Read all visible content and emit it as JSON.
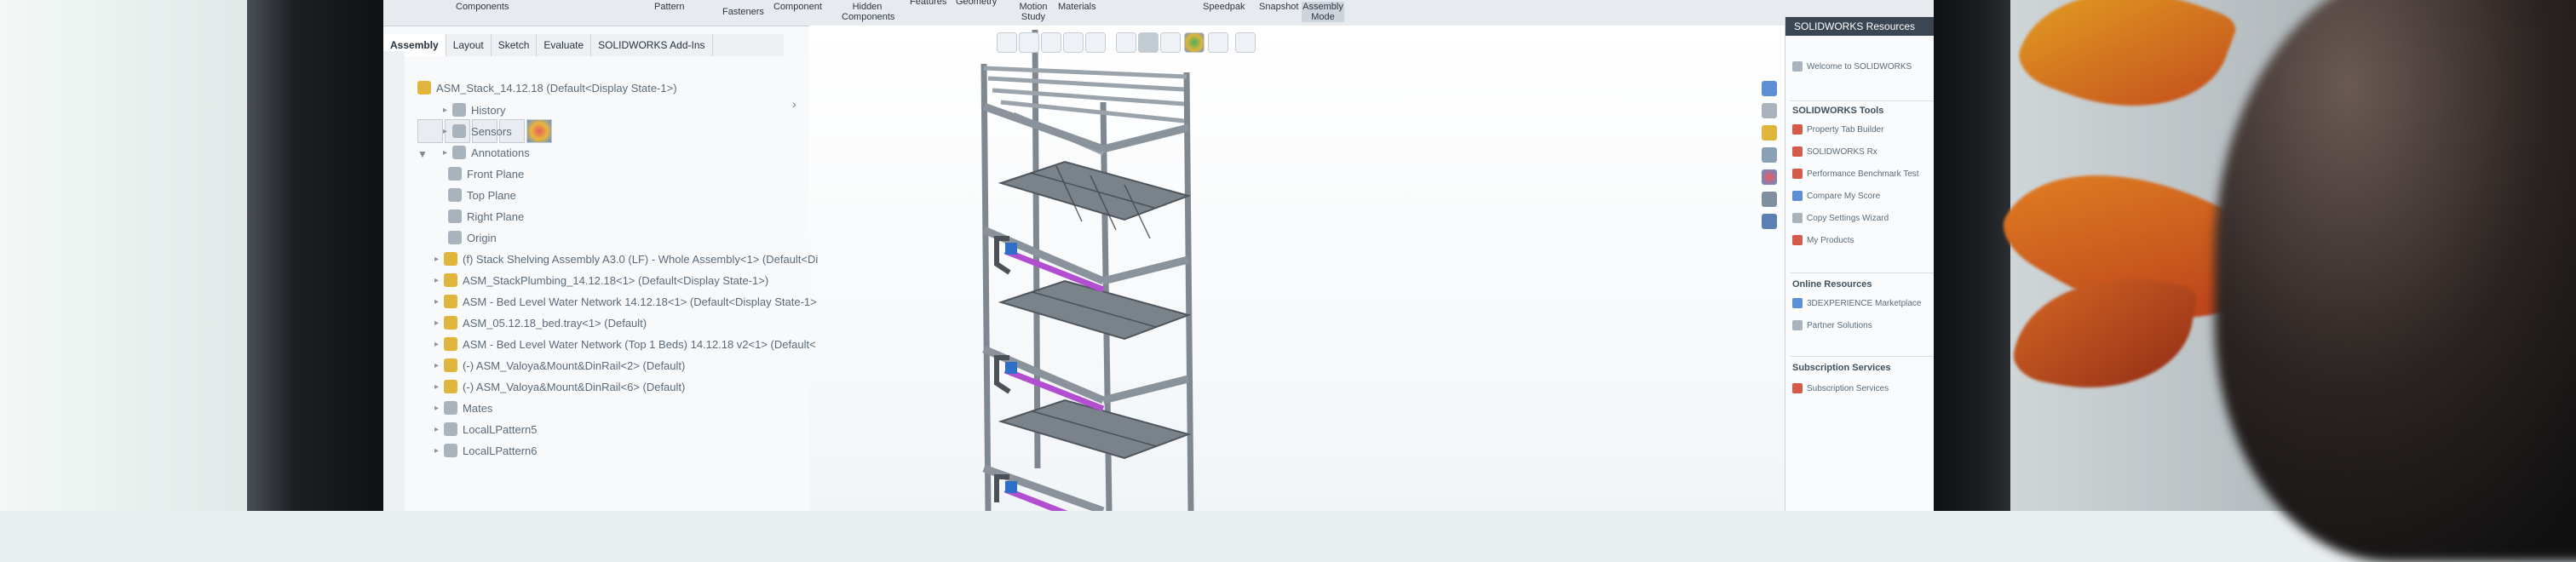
{
  "ribbon": {
    "items": [
      "Components",
      "Pattern",
      "Fasteners",
      "Component",
      "Hidden Components",
      "Features",
      "Geometry",
      "Motion Study",
      "Materials",
      "Speedpak",
      "Snapshot",
      "Assembly Mode"
    ]
  },
  "tabs": [
    "Assembly",
    "Layout",
    "Sketch",
    "Evaluate",
    "SOLIDWORKS Add-Ins"
  ],
  "tree": {
    "root": "ASM_Stack_14.12.18  (Default<Display State-1>)",
    "items": [
      {
        "label": "History",
        "icon": "folder-icon"
      },
      {
        "label": "Sensors",
        "icon": "sensor-icon"
      },
      {
        "label": "Annotations",
        "icon": "annotation-icon"
      },
      {
        "label": "Front Plane",
        "icon": "plane-icon"
      },
      {
        "label": "Top Plane",
        "icon": "plane-icon"
      },
      {
        "label": "Right Plane",
        "icon": "plane-icon"
      },
      {
        "label": "Origin",
        "icon": "origin-icon"
      },
      {
        "label": "(f) Stack Shelving Assembly A3.0 (LF) - Whole Assembly<1> (Default<Di",
        "icon": "assembly-icon"
      },
      {
        "label": "ASM_StackPlumbing_14.12.18<1> (Default<Display State-1>)",
        "icon": "assembly-icon"
      },
      {
        "label": "ASM - Bed Level Water Network 14.12.18<1> (Default<Display State-1>",
        "icon": "assembly-icon"
      },
      {
        "label": "ASM_05.12.18_bed.tray<1> (Default)",
        "icon": "assembly-icon"
      },
      {
        "label": "ASM - Bed Level Water Network (Top 1 Beds) 14.12.18 v2<1> (Default<",
        "icon": "assembly-icon"
      },
      {
        "label": "(-) ASM_Valoya&Mount&DinRail<2> (Default)",
        "icon": "assembly-icon"
      },
      {
        "label": "(-) ASM_Valoya&Mount&DinRail<6> (Default)",
        "icon": "assembly-icon"
      },
      {
        "label": "Mates",
        "icon": "mates-icon"
      },
      {
        "label": "LocalLPattern5",
        "icon": "pattern-icon"
      },
      {
        "label": "LocalLPattern6",
        "icon": "pattern-icon"
      }
    ]
  },
  "taskpane": {
    "title": "SOLIDWORKS Resources",
    "welcome": "Welcome to SOLIDWORKS",
    "tools_heading": "SOLIDWORKS Tools",
    "tools": [
      "Property Tab Builder",
      "SOLIDWORKS Rx",
      "Performance Benchmark Test",
      "Compare My Score",
      "Copy Settings Wizard",
      "My Products"
    ],
    "online_heading": "Online Resources",
    "online": [
      "3DEXPERIENCE Marketplace",
      "Partner Solutions"
    ],
    "subscription_heading": "Subscription Services",
    "subscription": [
      "Subscription Services"
    ]
  },
  "colors": {
    "tubing": "#b24fd0",
    "valve": "#2f6fc7",
    "frame": "#9aa3ab",
    "tray": "#6f7780"
  }
}
